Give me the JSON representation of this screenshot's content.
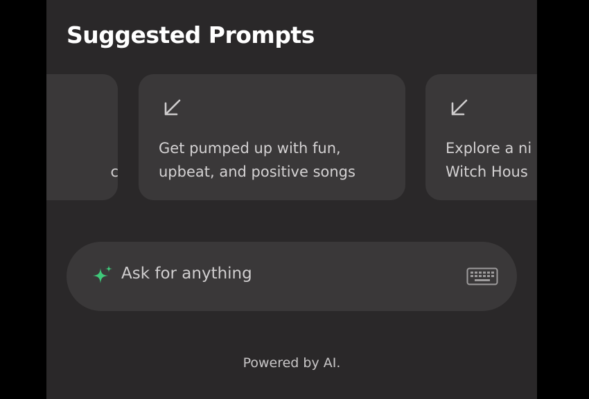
{
  "header": {
    "title": "Suggested Prompts"
  },
  "prompts": [
    {
      "text_line1": "",
      "text_line2": "c"
    },
    {
      "text_line1": "Get pumped up with fun,",
      "text_line2": "upbeat, and positive songs"
    },
    {
      "text_line1": "Explore a ni",
      "text_line2": "Witch Hous"
    }
  ],
  "search": {
    "placeholder": "Ask for anything",
    "icon": "sparkle-icon",
    "right_icon": "keyboard-icon"
  },
  "footer": {
    "text": "Powered by AI."
  },
  "colors": {
    "background": "#2a2829",
    "card": "#3a3839",
    "accent": "#3fc97a"
  }
}
